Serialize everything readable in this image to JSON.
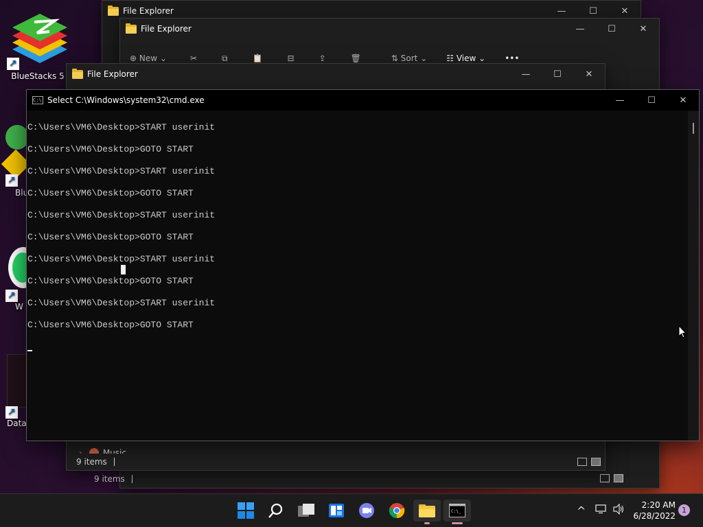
{
  "desktop": {
    "icons": [
      {
        "label": "BlueStacks 5"
      },
      {
        "label": "Blu"
      },
      {
        "label": "W"
      },
      {
        "label": "Data\\"
      }
    ]
  },
  "explorer_back": {
    "title": "File Explorer",
    "minimize": "—",
    "maximize": "☐",
    "close": "✕"
  },
  "explorer_mid": {
    "title": "File Explorer",
    "toolbar": {
      "new_label": "New",
      "sort_label": "Sort",
      "view_label": "View",
      "more_label": "•••"
    },
    "status": "9 items",
    "minimize": "—",
    "maximize": "☐",
    "close": "✕"
  },
  "explorer_front": {
    "title": "File Explorer",
    "nav_item": "Music",
    "status": "9 items",
    "minimize": "—",
    "maximize": "☐",
    "close": "✕"
  },
  "cmd": {
    "title": "Select C:\\Windows\\system32\\cmd.exe",
    "icon_text": "C:\\",
    "minimize": "—",
    "maximize": "☐",
    "close": "✕",
    "lines": [
      "C:\\Users\\VM6\\Desktop>START userinit",
      "C:\\Users\\VM6\\Desktop>GOTO START",
      "C:\\Users\\VM6\\Desktop>START userinit",
      "C:\\Users\\VM6\\Desktop>GOTO START",
      "C:\\Users\\VM6\\Desktop>START userinit",
      "C:\\Users\\VM6\\Desktop>GOTO START",
      "C:\\Users\\VM6\\Desktop>START userinit",
      "C:\\Users\\VM6\\Desktop>GOTO START",
      "C:\\Users\\VM6\\Desktop>START userinit",
      "C:\\Users\\VM6\\Desktop>GOTO START"
    ]
  },
  "taskbar": {
    "apps": [
      "start-icon",
      "search-icon",
      "task-view-icon",
      "widgets-icon",
      "teams-chat-icon",
      "chrome-icon",
      "file-explorer-icon",
      "cmd-icon"
    ],
    "tray": {
      "chevron": "^",
      "time": "2:20 AM",
      "date": "6/28/2022",
      "notifications": "1"
    }
  },
  "colors": {
    "console_bg": "#0c0c0c",
    "console_text": "#cccccc",
    "taskbar_bg": "#1c1c1c",
    "accent": "#0078d4"
  }
}
